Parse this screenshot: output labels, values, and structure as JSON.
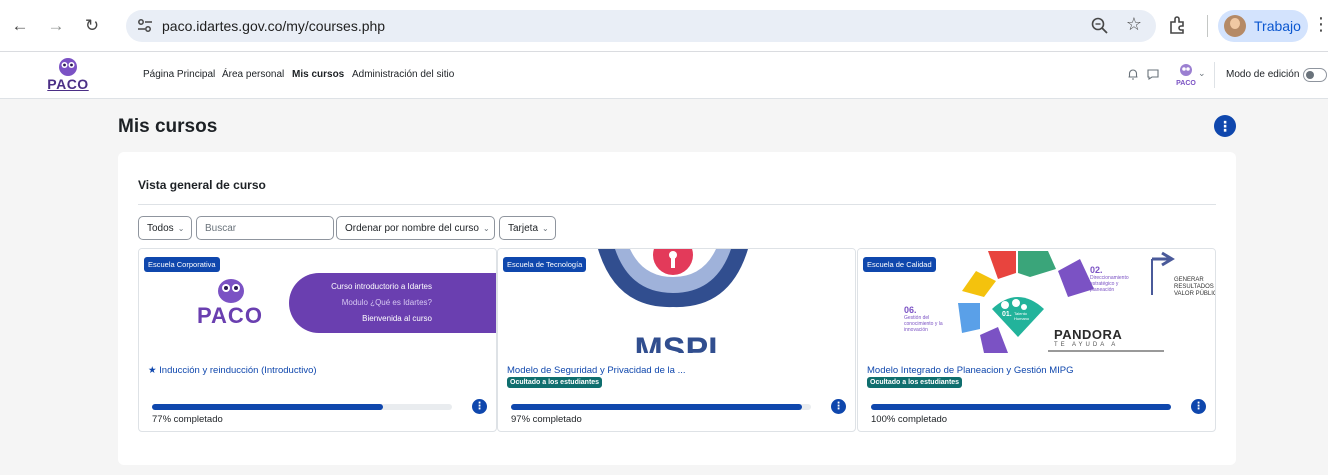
{
  "browser": {
    "url": "paco.idartes.gov.co/my/courses.php",
    "profile_name": "Trabajo"
  },
  "navbar": {
    "logo_text": "PACO",
    "links": [
      "Página Principal",
      "Área personal",
      "Mis cursos",
      "Administración del sitio"
    ],
    "edit_mode_label": "Modo de edición"
  },
  "page": {
    "title": "Mis cursos",
    "section_title": "Vista general de curso"
  },
  "filters": {
    "grouping": "Todos",
    "search_placeholder": "Buscar",
    "sort": "Ordenar por nombre del curso",
    "view": "Tarjeta"
  },
  "courses": [
    {
      "category": "Escuela Corporativa",
      "name": "Inducción y reinducción (Introductivo)",
      "starred": true,
      "hidden_label": "",
      "progress": 77,
      "progress_text": "77% completado",
      "banner": {
        "logo": "PACO",
        "line1": "Curso introductorio a Idartes",
        "line2": "Modulo ¿Qué es Idartes?",
        "line3": "Bienvenida al curso"
      }
    },
    {
      "category": "Escuela de Tecnología",
      "name": "Modelo de Seguridad y Privacidad de la ...",
      "starred": false,
      "hidden_label": "Ocultado a los estudiantes",
      "progress": 97,
      "progress_text": "97% completado"
    },
    {
      "category": "Escuela de Calidad",
      "name": "Modelo Integrado de Planeacion y Gestión MIPG",
      "starred": false,
      "hidden_label": "Ocultado a los estudiantes",
      "progress": 100,
      "progress_text": "100% completado",
      "banner": {
        "label_02": "02.",
        "label_02_text": "Direccionamiento estratégico y planeación",
        "label_06": "06.",
        "label_06_text": "Gestión del conocimiento y la innovación",
        "label_01": "01.",
        "label_01_text": "Talento Humano",
        "right_text": "GENERAR RESULTADOS Y VALOR PÚBLICO",
        "brand": "PANDORA",
        "brand_sub": "TE AYUDA A"
      }
    }
  ],
  "colors": {
    "primary": "#0f47ad",
    "hidden_badge": "#0f6e6e",
    "paco_purple": "#6a3fb0"
  }
}
